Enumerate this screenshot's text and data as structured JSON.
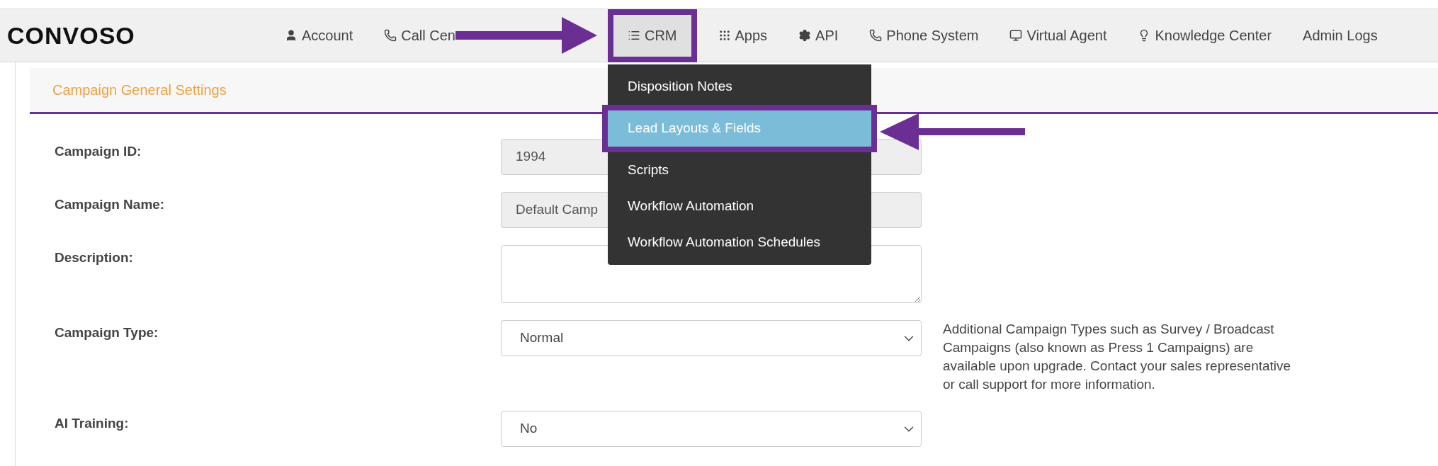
{
  "logo": "CONVOSO",
  "nav": [
    {
      "label": "Account",
      "selected": false
    },
    {
      "label": "Call Cen",
      "selected": false
    },
    {
      "label": "CRM",
      "selected": true
    },
    {
      "label": "Apps",
      "selected": false
    },
    {
      "label": "API",
      "selected": false
    },
    {
      "label": "Phone System",
      "selected": false
    },
    {
      "label": "Virtual Agent",
      "selected": false
    },
    {
      "label": "Knowledge Center",
      "selected": false
    },
    {
      "label": "Admin Logs",
      "selected": false
    }
  ],
  "crm_menu": [
    {
      "label": "Disposition Notes",
      "selected": false
    },
    {
      "label": "Lead Layouts & Fields",
      "selected": true
    },
    {
      "label": "Scripts",
      "selected": false
    },
    {
      "label": "Workflow Automation",
      "selected": false
    },
    {
      "label": "Workflow Automation Schedules",
      "selected": false
    }
  ],
  "panel": {
    "title": "Campaign General Settings",
    "fields": [
      {
        "label": "Campaign ID:",
        "kind": "readonly",
        "value": "1994"
      },
      {
        "label": "Campaign Name:",
        "kind": "readonly",
        "value": "Default Camp"
      },
      {
        "label": "Description:",
        "kind": "textarea"
      },
      {
        "label": "Campaign Type:",
        "kind": "select",
        "value": "Normal",
        "help": "Additional Campaign Types such as Survey / Broadcast Campaigns (also known as Press 1 Campaigns) are available upon upgrade. Contact your sales representative or call support for more information."
      },
      {
        "label": "AI Training:",
        "kind": "select",
        "value": "No"
      }
    ]
  }
}
